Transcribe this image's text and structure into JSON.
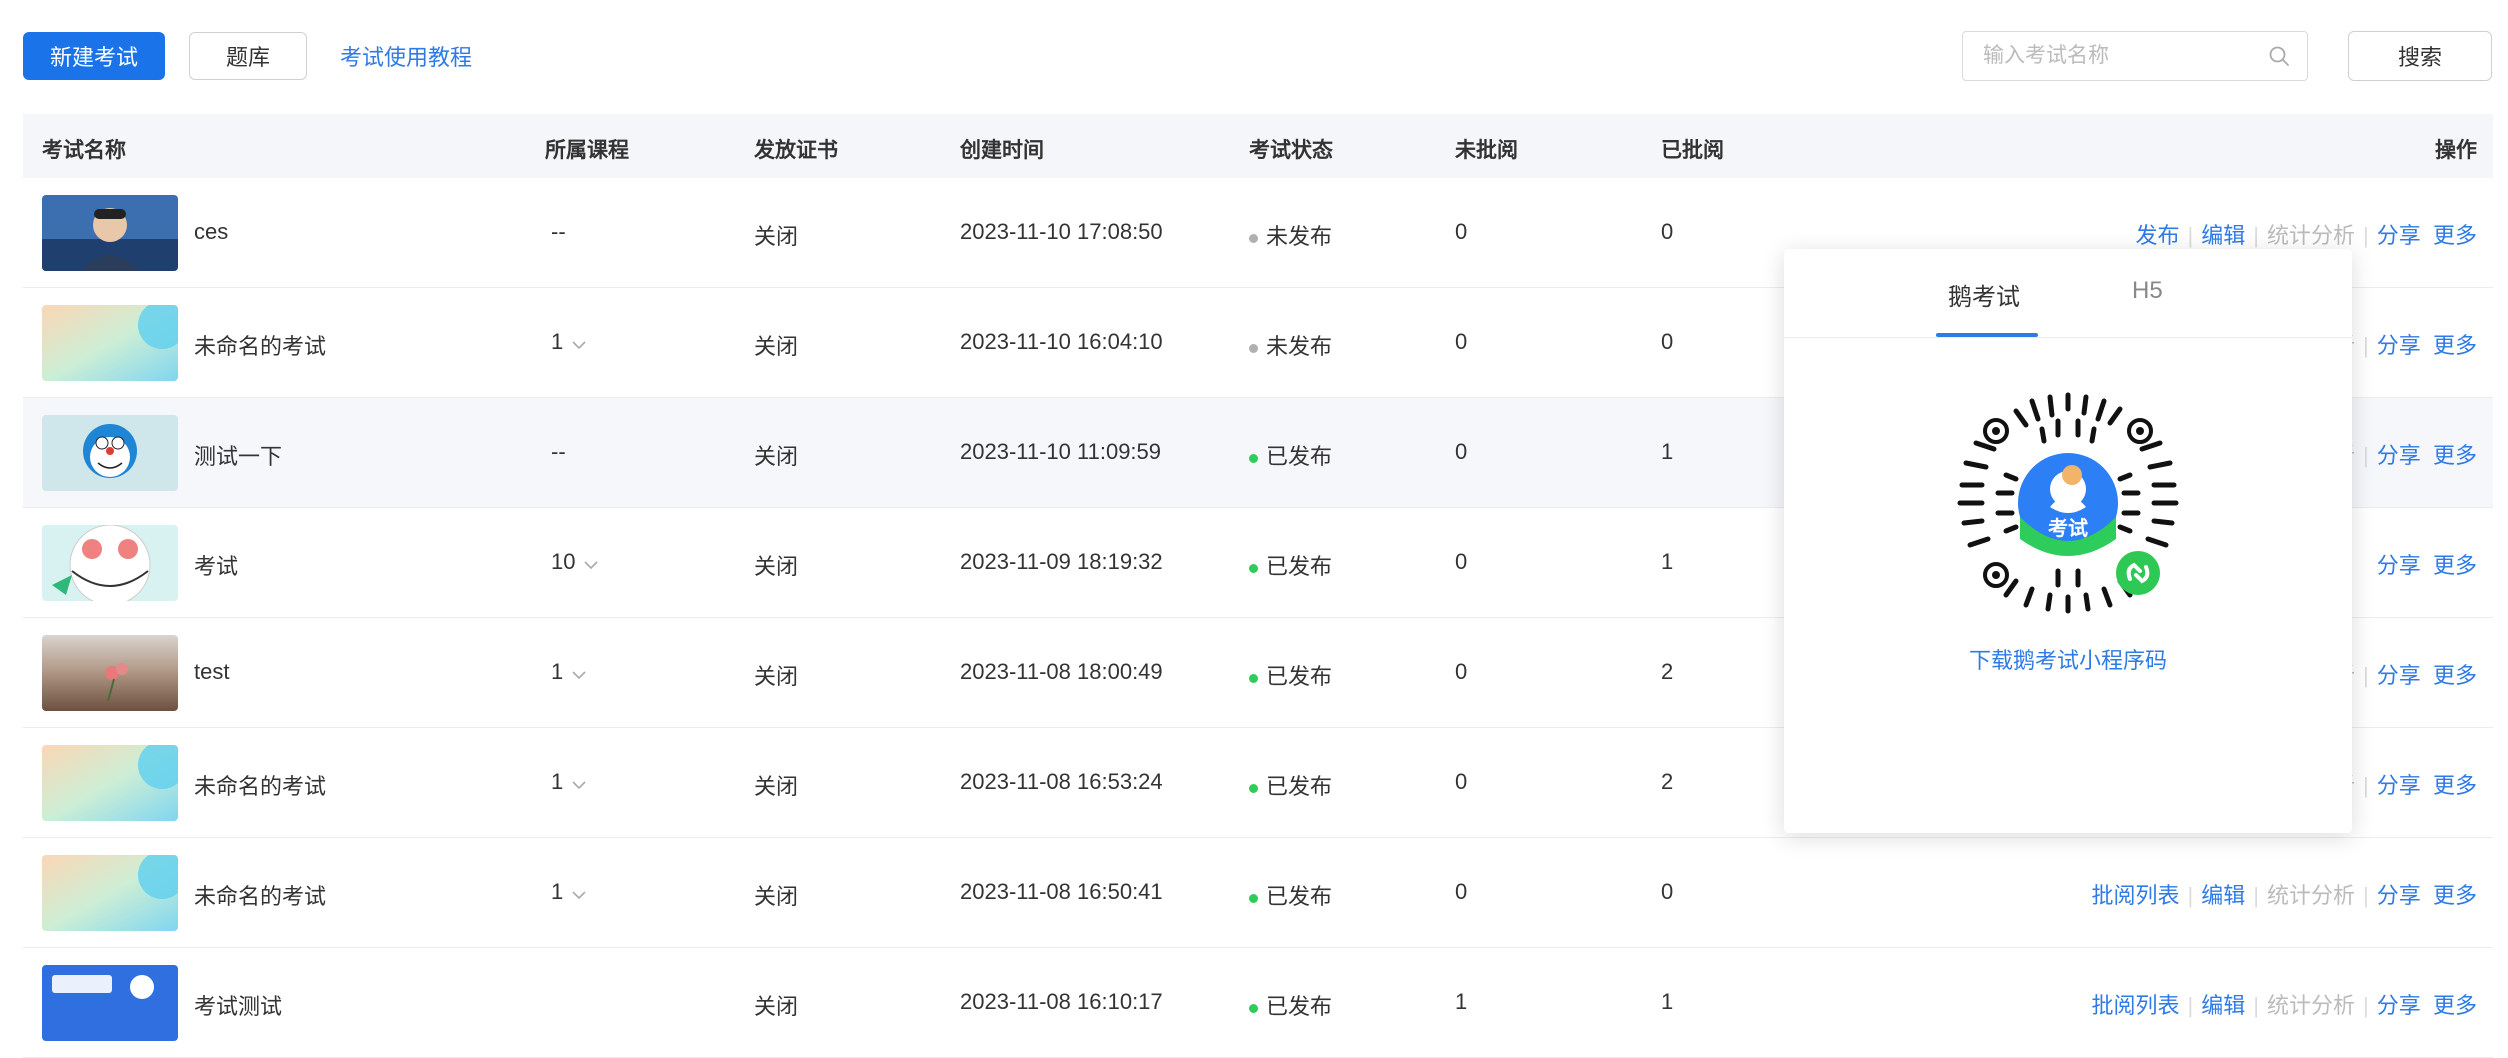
{
  "toolbar": {
    "new_exam_label": "新建考试",
    "question_bank_label": "题库",
    "tutorial_label": "考试使用教程",
    "search_placeholder": "输入考试名称",
    "search_button_label": "搜索"
  },
  "table": {
    "columns": {
      "name": "考试名称",
      "course": "所属课程",
      "certificate": "发放证书",
      "created": "创建时间",
      "status": "考试状态",
      "unreviewed": "未批阅",
      "reviewed": "已批阅",
      "actions": "操作"
    },
    "rows": [
      {
        "name": "ces",
        "course": "--",
        "certificate": "关闭",
        "created": "2023-11-10 17:08:50",
        "status": "未发布",
        "unreviewed": "0",
        "reviewed": "0",
        "actions": {
          "first": "发布",
          "edit": "编辑",
          "stats": "统计分析",
          "share": "分享",
          "more": "更多"
        }
      },
      {
        "name": "未命名的考试",
        "course": "1",
        "certificate": "关闭",
        "created": "2023-11-10 16:04:10",
        "status": "未发布",
        "unreviewed": "0",
        "reviewed": "0",
        "actions": {
          "stats_tail": "析",
          "share": "分享",
          "more": "更多"
        }
      },
      {
        "name": "测试一下",
        "course": "--",
        "certificate": "关闭",
        "created": "2023-11-10 11:09:59",
        "status": "已发布",
        "unreviewed": "0",
        "reviewed": "1",
        "actions": {
          "stats_tail": "析",
          "share": "分享",
          "more": "更多"
        }
      },
      {
        "name": "考试",
        "course": "10",
        "certificate": "关闭",
        "created": "2023-11-09 18:19:32",
        "status": "已发布",
        "unreviewed": "0",
        "reviewed": "1",
        "actions": {
          "stats_tail": "",
          "share": "分享",
          "more": "更多"
        }
      },
      {
        "name": "test",
        "course": "1",
        "certificate": "关闭",
        "created": "2023-11-08 18:00:49",
        "status": "已发布",
        "unreviewed": "0",
        "reviewed": "2",
        "actions": {
          "stats_tail": "析",
          "share": "分享",
          "more": "更多"
        }
      },
      {
        "name": "未命名的考试",
        "course": "1",
        "certificate": "关闭",
        "created": "2023-11-08 16:53:24",
        "status": "已发布",
        "unreviewed": "0",
        "reviewed": "2",
        "actions": {
          "stats_tail": "析",
          "share": "分享",
          "more": "更多"
        }
      },
      {
        "name": "未命名的考试",
        "course": "1",
        "certificate": "关闭",
        "created": "2023-11-08 16:50:41",
        "status": "已发布",
        "unreviewed": "0",
        "reviewed": "0",
        "actions": {
          "first": "批阅列表",
          "edit": "编辑",
          "stats": "统计分析",
          "share": "分享",
          "more": "更多"
        }
      },
      {
        "name": "考试测试",
        "course": "",
        "certificate": "关闭",
        "created": "2023-11-08 16:10:17",
        "status": "已发布",
        "unreviewed": "1",
        "reviewed": "1",
        "actions": {
          "first": "批阅列表",
          "edit": "编辑",
          "stats": "统计分析",
          "share": "分享",
          "more": "更多"
        }
      }
    ]
  },
  "popover": {
    "tabs": [
      "鹅考试",
      "H5"
    ],
    "active_tab": "鹅考试",
    "qr_badge_label": "考试",
    "download_label": "下载鹅考试小程序码"
  },
  "colors": {
    "primary": "#1a73e8",
    "link": "#2e7be6",
    "status_published": "#2ecc5a",
    "status_unpublished": "#b0b0b0",
    "header_bg": "#f4f6f9"
  },
  "icons": {
    "search": "magnifier-icon",
    "dropdown": "chevron-down-icon",
    "miniprogram": "wechat-miniprogram-icon"
  }
}
